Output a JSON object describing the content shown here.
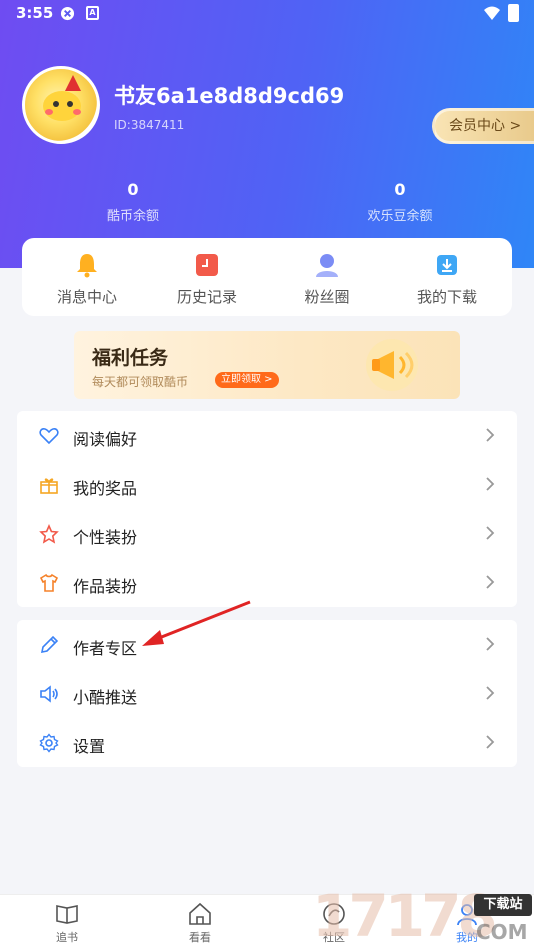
{
  "status_bar": {
    "time": "3:55"
  },
  "profile": {
    "username": "书友6a1e8d8d9cd69",
    "user_id": "ID:3847411",
    "vip_button": "会员中心 >"
  },
  "stats": [
    {
      "value": "0",
      "label": "酷币余额"
    },
    {
      "value": "0",
      "label": "欢乐豆余额"
    }
  ],
  "quick_actions": [
    {
      "label": "消息中心",
      "icon": "bell-icon"
    },
    {
      "label": "历史记录",
      "icon": "history-icon"
    },
    {
      "label": "粉丝圈",
      "icon": "fans-icon"
    },
    {
      "label": "我的下载",
      "icon": "download-icon"
    }
  ],
  "banner": {
    "title": "福利任务",
    "subtitle": "每天都可领取酷币",
    "button": "立即领取 >"
  },
  "menu_group_1": [
    {
      "label": "阅读偏好",
      "icon": "heart-icon"
    },
    {
      "label": "我的奖品",
      "icon": "gift-icon"
    },
    {
      "label": "个性装扮",
      "icon": "star-icon"
    },
    {
      "label": "作品装扮",
      "icon": "shirt-icon"
    }
  ],
  "menu_group_2": [
    {
      "label": "作者专区",
      "icon": "pencil-icon"
    },
    {
      "label": "小酷推送",
      "icon": "speaker-icon"
    },
    {
      "label": "设置",
      "icon": "gear-icon"
    }
  ],
  "tab_bar": [
    {
      "label": "追书",
      "icon": "book-icon"
    },
    {
      "label": "看看",
      "icon": "home-icon"
    },
    {
      "label": "社区",
      "icon": "community-icon"
    },
    {
      "label": "我的",
      "icon": "user-icon"
    }
  ],
  "watermark": {
    "number": "17178",
    "badge": "下载站",
    "domain": "COM"
  },
  "colors": {
    "accent": "#3b82f6",
    "header_start": "#6f4cf2",
    "header_end": "#2f86f7",
    "banner_button": "#ff6a1a",
    "annotation_arrow": "#e02424"
  }
}
